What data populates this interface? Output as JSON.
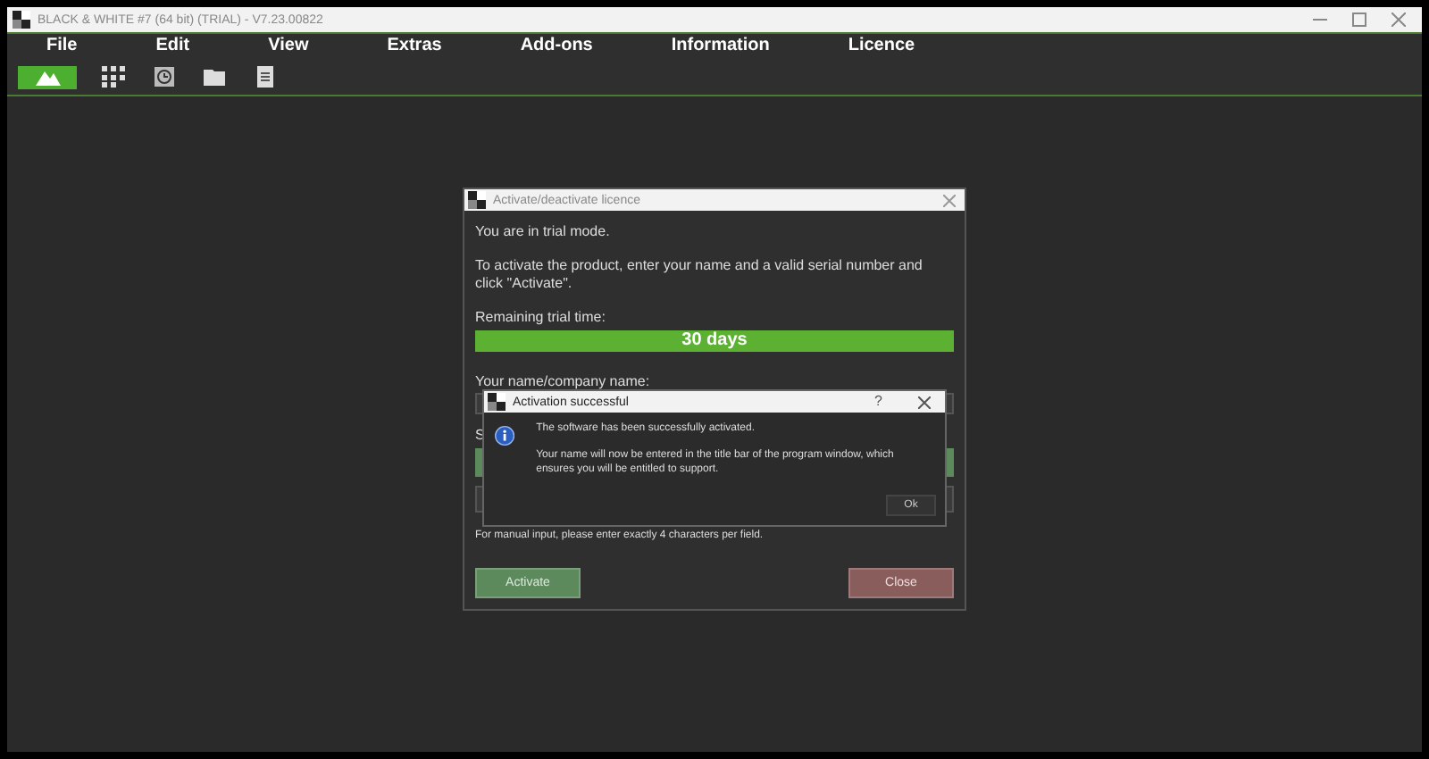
{
  "window": {
    "title": "BLACK & WHITE #7 (64 bit) (TRIAL) - V7.23.00822"
  },
  "menu": [
    "File",
    "Edit",
    "View",
    "Extras",
    "Add-ons",
    "Information",
    "Licence"
  ],
  "toolbar": [
    {
      "kind": "brand",
      "selected": true
    },
    {
      "kind": "grid",
      "selected": false
    },
    {
      "kind": "clock",
      "selected": false
    },
    {
      "kind": "folder",
      "selected": false
    },
    {
      "kind": "document",
      "selected": false
    }
  ],
  "licence_dialog": {
    "title": "Activate/deactivate licence",
    "trial_note": "You are in trial mode.",
    "instructions": "To activate the product, enter your name and a valid serial number and click \"Activate\".",
    "remaining_label": "Remaining trial time:",
    "remaining": {
      "text": "30 days",
      "level": 1
    },
    "name_label": "Your name/company name:",
    "serial_label": "S",
    "manual_note": "For manual input, please enter exactly 4 characters per field.",
    "buttons": [
      {
        "label": "Activate",
        "kind": "confirm"
      },
      {
        "label": "Close",
        "kind": "cancel"
      }
    ]
  },
  "message_box": {
    "title": "Activation successful",
    "help": "?",
    "message": "The software has been successfully activated.",
    "detail": "Your name will now be entered in the title bar of the program window, which ensures you will be entitled to support.",
    "ok": "Ok"
  }
}
